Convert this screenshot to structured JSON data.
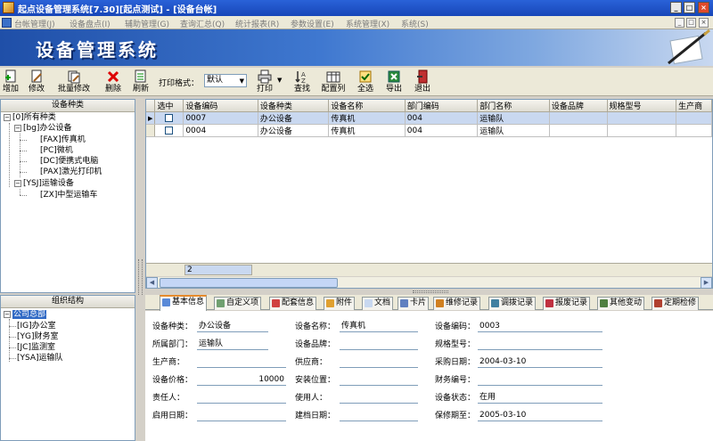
{
  "window": {
    "title": "起点设备管理系统[7.30][起点测试] - [设备台帐]",
    "minimize_glyph": "_",
    "restore_glyph": "□",
    "close_glyph": "×"
  },
  "menu": {
    "items": [
      "台帐管理(J)",
      "设备盘点(I)",
      "辅助管理(G)",
      "查询汇总(Q)",
      "统计报表(R)",
      "参数设置(E)",
      "系统管理(X)",
      "系统(S)"
    ],
    "mdi_min": "_",
    "mdi_restore": "□",
    "mdi_close": "×"
  },
  "banner": {
    "title": "设备管理系统"
  },
  "toolbar": {
    "buttons": [
      {
        "label": "增加",
        "icon": "add-icon"
      },
      {
        "label": "修改",
        "icon": "edit-icon"
      },
      {
        "label": "批量修改",
        "icon": "batch-edit-icon"
      },
      {
        "label": "删除",
        "icon": "delete-icon"
      },
      {
        "label": "刷新",
        "icon": "refresh-icon"
      },
      {
        "label": "打印",
        "icon": "printer-icon"
      },
      {
        "label": "查找",
        "icon": "find-icon"
      },
      {
        "label": "配置列",
        "icon": "columns-icon"
      },
      {
        "label": "全选",
        "icon": "select-all-icon"
      },
      {
        "label": "导出",
        "icon": "export-icon"
      },
      {
        "label": "退出",
        "icon": "exit-icon"
      }
    ],
    "print_format_label": "打印格式：",
    "print_format_value": "默认",
    "dropdown_arrow": "▼"
  },
  "category_panel": {
    "header": "设备种类",
    "nodes": [
      "[0]所有种类",
      "[bg]办公设备",
      "[FAX]传真机",
      "[PC]微机",
      "[DC]便携式电脑",
      "[PAX]激光打印机",
      "[YSJ]运输设备",
      "[ZX]中型运输车"
    ],
    "collapse_glyph": "−"
  },
  "org_panel": {
    "header": "组织结构",
    "nodes": [
      "公司总部",
      "[IG]办公室",
      "[YG]财务室",
      "[JC]监测室",
      "[YSA]运输队"
    ],
    "collapse_glyph": "−"
  },
  "grid": {
    "columns": [
      "选中",
      "设备编码",
      "设备种类",
      "设备名称",
      "部门编码",
      "部门名称",
      "设备品牌",
      "规格型号",
      "生产商"
    ],
    "rows": [
      {
        "indicator": "▶",
        "code": "0007",
        "category": "办公设备",
        "name": "传真机",
        "dept_code": "004",
        "dept_name": "运输队",
        "brand": "",
        "model": "",
        "maker": ""
      },
      {
        "indicator": "",
        "code": "0004",
        "category": "办公设备",
        "name": "传真机",
        "dept_code": "004",
        "dept_name": "运输队",
        "brand": "",
        "model": "",
        "maker": ""
      }
    ],
    "footer_count": "2",
    "scroll_left": "◀",
    "scroll_right": "▶"
  },
  "tabs": [
    "基本信息",
    "自定义项",
    "配套信息",
    "附件",
    "文档",
    "卡片",
    "维修记录",
    "调拨记录",
    "报废记录",
    "其他变动",
    "定期检修"
  ],
  "form": {
    "category_label": "设备种类：",
    "category_value": "办公设备",
    "name_label": "设备名称：",
    "name_value": "传真机",
    "code_label": "设备编码：",
    "code_value": "0003",
    "dept_label": "所属部门：",
    "dept_value": "运输队",
    "brand_label": "设备品牌：",
    "brand_value": "",
    "model_label": "规格型号：",
    "model_value": "",
    "maker_label": "生产商：",
    "maker_value": "",
    "supplier_label": "供应商：",
    "supplier_value": "",
    "purchase_date_label": "采购日期：",
    "purchase_date_value": "2004-03-10",
    "price_label": "设备价格：",
    "price_value": "10000",
    "location_label": "安装位置：",
    "location_value": "",
    "asset_no_label": "财务编号：",
    "asset_no_value": "",
    "owner_label": "责任人：",
    "owner_value": "",
    "user_label": "使用人：",
    "user_value": "",
    "status_label": "设备状态：",
    "status_value": "在用",
    "start_date_label": "启用日期：",
    "start_date_value": "",
    "file_date_label": "建档日期：",
    "file_date_value": "",
    "warranty_label": "保修期至：",
    "warranty_value": "2005-03-10"
  }
}
